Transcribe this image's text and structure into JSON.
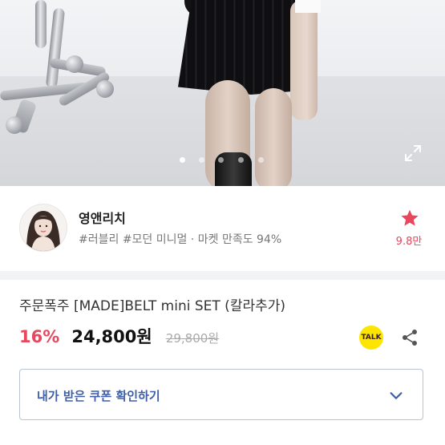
{
  "hero": {
    "slide_count": 5,
    "active_slide": 0
  },
  "shop": {
    "name": "영앤리치",
    "tags": "#러블리 #모던 미니멀 · 마켓 만족도 94%",
    "likes": "9.8만",
    "accent_color": "#e8475d"
  },
  "product": {
    "title": "주문폭주 [MADE]BELT mini SET (칼라추가)",
    "discount": "16%",
    "price": "24,800원",
    "original_price": "29,800원"
  },
  "actions": {
    "talk_label": "TALK"
  },
  "coupon": {
    "label": "내가 받은 쿠폰 확인하기",
    "color": "#3f5fa8"
  },
  "icons": [
    "expand-icon",
    "star-icon",
    "kakao-talk-icon",
    "share-icon",
    "chevron-down-icon"
  ]
}
